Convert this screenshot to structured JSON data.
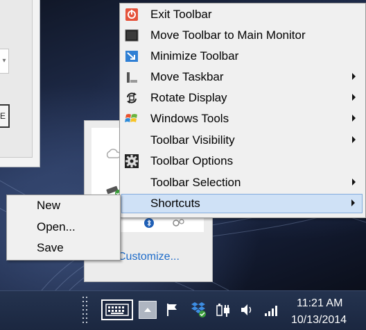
{
  "context_menu": {
    "items": [
      {
        "label": "Exit Toolbar",
        "icon": "power-icon",
        "submenu": false
      },
      {
        "label": "Move Toolbar to Main Monitor",
        "icon": "monitor-icon",
        "submenu": false
      },
      {
        "label": "Minimize Toolbar",
        "icon": "minimize-icon",
        "submenu": false
      },
      {
        "label": "Move Taskbar",
        "icon": "taskbar-icon",
        "submenu": true
      },
      {
        "label": "Rotate Display",
        "icon": "rotate-icon",
        "submenu": true
      },
      {
        "label": "Windows Tools",
        "icon": "windows-logo-icon",
        "submenu": true
      },
      {
        "label": "Toolbar Visibility",
        "icon": "",
        "submenu": true
      },
      {
        "label": "Toolbar Options",
        "icon": "gear-icon",
        "submenu": false
      },
      {
        "label": "Toolbar Selection",
        "icon": "",
        "submenu": true
      },
      {
        "label": "Shortcuts",
        "icon": "",
        "submenu": true,
        "highlighted": true
      }
    ]
  },
  "sub_menu": {
    "items": [
      "New",
      "Open...",
      "Save"
    ]
  },
  "tray_panel": {
    "customize_label": "Customize..."
  },
  "taskbar": {
    "clock_time": "11:21 AM",
    "clock_date": "10/13/2014"
  },
  "colors": {
    "menu_bg": "#f0f0f0",
    "menu_highlight": "#cfe1f6",
    "link": "#1d6bc9",
    "taskbar": "#1e2b45"
  }
}
